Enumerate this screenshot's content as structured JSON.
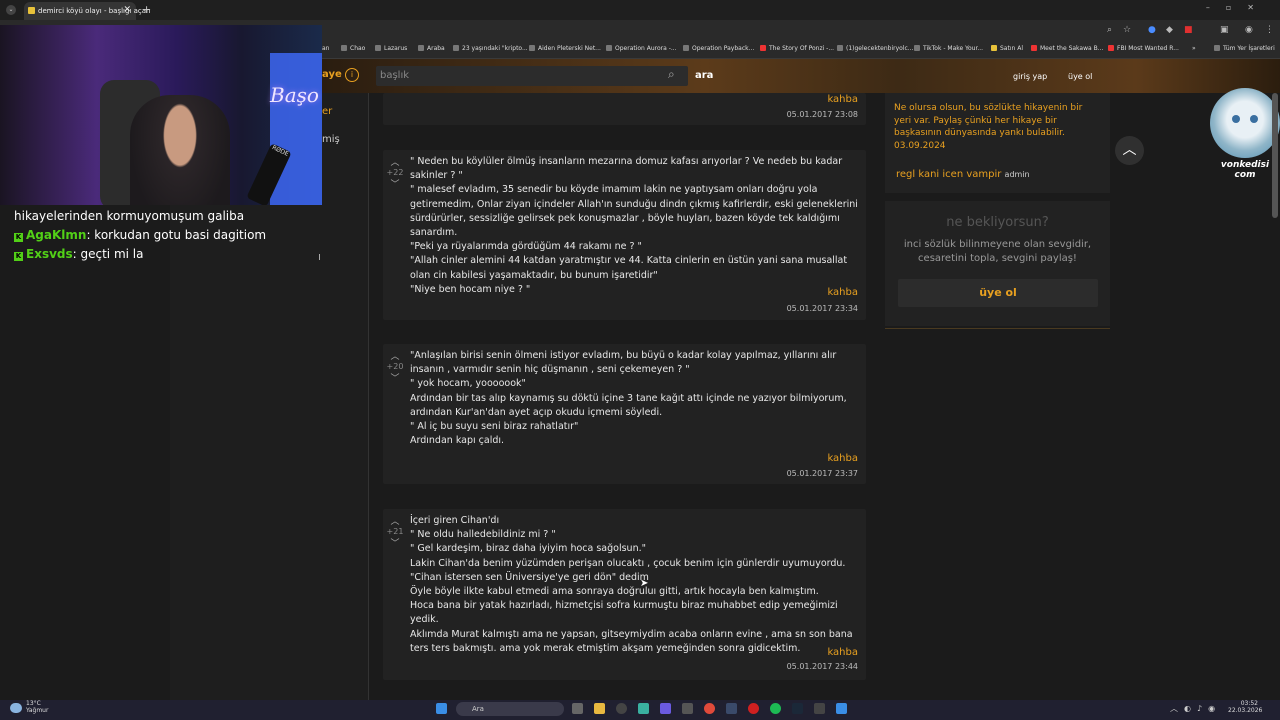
{
  "browser": {
    "tab_title": "demirci köyü olayı - başlığı açan",
    "bookmarks": [
      "Chao",
      "Lazarus",
      "Araba",
      "23 yaşındaki \"kripto...",
      "Aiden Pleterski Net...",
      "Operation Aurora -...",
      "Operation Payback...",
      "The Story Of Ponzi -...",
      "(1)gelecektenbiryolc...",
      "TikTok - Make Your...",
      "Satın Al",
      "Meet the Sakawa B...",
      "FBI Most Wanted R...",
      "»",
      "Tüm Yer İşaretleri"
    ],
    "bookmark_partial": "an"
  },
  "site": {
    "logo_fragment": "aye",
    "search_placeholder": "başlık",
    "search_button": "ara",
    "login": "giriş yap",
    "register": "üye ol",
    "left_nav_fragments": [
      "er",
      "miş"
    ]
  },
  "entries": [
    {
      "author": "kahba",
      "date": "05.01.2017 23:08",
      "lines": [],
      "score": ""
    },
    {
      "score": "+22",
      "lines": [
        "\" Neden bu köylüler ölmüş insanların mezarına domuz kafası arıyorlar ? Ve nedeb bu kadar sakinler ? \"",
        "\" malesef evladım, 35 senedir bu köyde imamım lakin ne yaptıysam onları doğru yola getiremedim, Onlar ziyan içindeler Allah'ın sunduğu dindn çıkmış kafirlerdir, eski geleneklerini sürdürürler, sessizliğe gelirsek pek konuşmazlar , böyle huyları, bazen köyde tek kaldığımı sanardım.",
        "\"Peki ya rüyalarımda gördüğüm 44 rakamı ne ? \"",
        "\"Allah cinler alemini 44 katdan yaratmıştır ve 44. Katta cinlerin en üstün yani sana musallat olan cin kabilesi yaşamaktadır, bu bunum işaretidir\"",
        "\"Niye ben hocam niye ? \""
      ],
      "author": "kahba",
      "date": "05.01.2017 23:34"
    },
    {
      "score": "+20",
      "lines": [
        "\"Anlaşılan birisi senin ölmeni istiyor evladım, bu büyü o kadar kolay yapılmaz, yıllarını alır insanın , varmıdır senin hiç düşmanın , seni çekemeyen ? \"",
        "\" yok hocam, yooooook\"",
        "Ardından bir tas alıp kaynamış su döktü içine 3 tane kağıt attı içinde ne yazıyor bilmiyorum, ardından Kur'an'dan ayet açıp okudu içmemi söyledi.",
        "\" Al iç bu suyu seni biraz rahatlatır\"",
        "Ardından kapı çaldı."
      ],
      "author": "kahba",
      "date": "05.01.2017 23:37"
    },
    {
      "score": "+21",
      "lines": [
        "İçeri giren Cihan'dı",
        "\" Ne oldu halledebildiniz mi ? \"",
        "\" Gel kardeşim, biraz daha iyiyim hoca sağolsun.\"",
        "Lakin Cihan'da benim yüzümden perişan olucaktı , çocuk benim için günlerdir uyumuyordu.",
        "\"Cihan istersen sen Üniversiye'ye geri dön\" dedim",
        "Öyle böyle ilkte kabul etmedi ama sonraya doğruluı gitti, artık hocayla ben kalmıştım.",
        "Hoca bana bir yatak hazırladı, hizmetçisi sofra kurmuştu biraz muhabbet edip yemeğimizi yedik.",
        "Aklımda Murat kalmıştı ama ne yapsan, gitseymiydim acaba onların evine , ama sn son bana ters ters bakmıştı. ama yok merak etmiştim akşam yemeğinden sonra gidicektim."
      ],
      "author": "kahba",
      "date": "05.01.2017 23:44"
    }
  ],
  "sidebar": {
    "motto": "Ne olursa olsun, bu sözlükte hikayenin bir yeri var. Paylaş çünkü her hikaye bir başkasının dünyasında yankı bulabilir. 03.09.2024",
    "user": "regl kani icen vampir",
    "role": "admin",
    "cta_title": "ne bekliyorsun?",
    "cta_text": "inci sözlük bilinmeyene olan sevgidir, cesaretini topla, sevgini paylaş!",
    "cta_button": "üye ol"
  },
  "overlay": {
    "neon": "Başo",
    "mic_brand": "RØDE",
    "cat_name": "vonkedisi com",
    "chat": [
      {
        "user": "",
        "text": "hikayelerinden kormuyomuşum galiba"
      },
      {
        "user": "AgaKlmn",
        "text": "korkudan gotu basi dagitiom"
      },
      {
        "user": "Exsvds",
        "text": "geçti mi la"
      }
    ]
  },
  "taskbar": {
    "weather_temp": "13°C",
    "weather_desc": "Yağmur",
    "search": "Ara",
    "time": "03:52",
    "date": "22.03.2026"
  }
}
